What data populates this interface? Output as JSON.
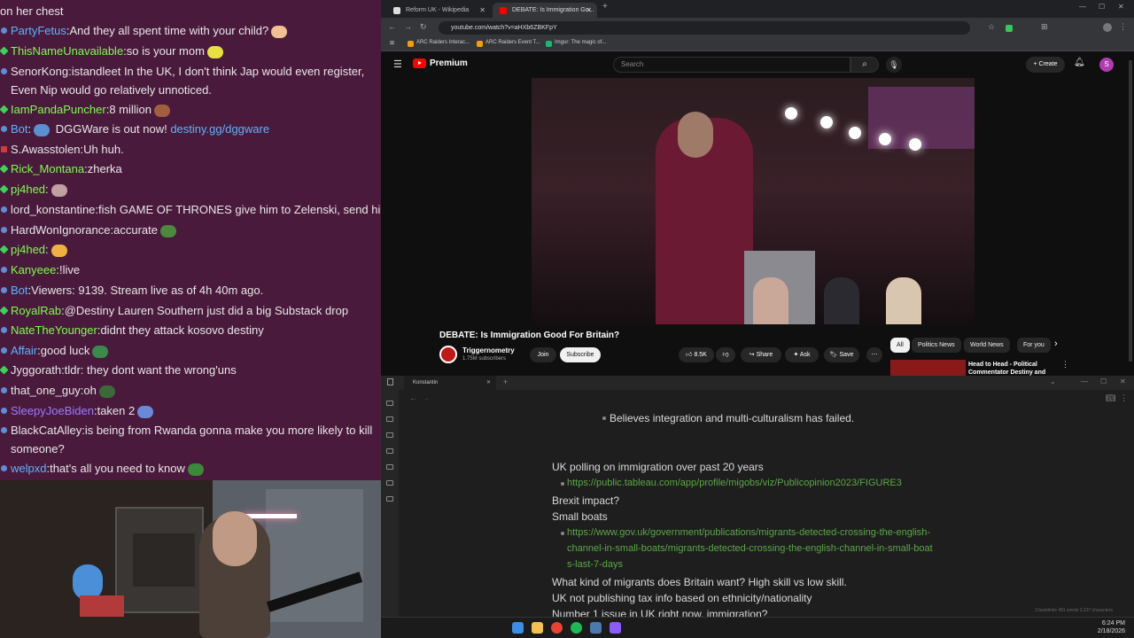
{
  "chat": {
    "messages": [
      {
        "user": "",
        "text": "on her chest",
        "user_color": "#ffffff"
      },
      {
        "user": "PartyFetus",
        "text": "And they all spent time with your child?",
        "user_color": "#5ab4ff"
      },
      {
        "user": "ThisNameUnavailable",
        "text": "so is your mom",
        "user_color": "#7cff4a"
      },
      {
        "user": "SenorKong",
        "text": "istandleet In the UK, I don't think Jap would even register, Even Nip would go relatively unnoticed.",
        "user_color": "#e8e8e8"
      },
      {
        "user": "IamPandaPuncher",
        "text": "8 million",
        "user_color": "#7cff4a"
      },
      {
        "user": "Bot",
        "text": "DGGWare is out now!",
        "link": "destiny.gg/dggware",
        "user_color": "#5ab4ff"
      },
      {
        "user": "S.Awasstolen",
        "text": "Uh huh.",
        "user_color": "#e8e8e8"
      },
      {
        "user": "Rick_Montana",
        "text": "zherka",
        "user_color": "#7cff4a"
      },
      {
        "user": "pj4hed",
        "text": "",
        "user_color": "#7cff4a"
      },
      {
        "user": "lord_konstantine",
        "text": "fish GAME OF THRONES give him to Zelenski, send him back",
        "user_color": "#e8e8e8"
      },
      {
        "user": "HardWonIgnorance",
        "text": "accurate",
        "user_color": "#e8e8e8"
      },
      {
        "user": "pj4hed",
        "text": "",
        "user_color": "#7cff4a"
      },
      {
        "user": "Kanyeee",
        "text": "!live",
        "user_color": "#7cff4a"
      },
      {
        "user": "Bot",
        "text": "Viewers: 9139. Stream live as of 4h 40m ago.",
        "user_color": "#5ab4ff"
      },
      {
        "user": "RoyalRab",
        "text": "@Destiny Lauren Southern just did a big Substack drop",
        "user_color": "#7cff4a"
      },
      {
        "user": "NateTheYounger",
        "text": "didnt they attack kosovo destiny",
        "user_color": "#7cff4a"
      },
      {
        "user": "Affair",
        "text": "good luck",
        "user_color": "#5ab4ff"
      },
      {
        "user": "Jyggorath",
        "text": "tldr: they dont want the wrong'uns",
        "user_color": "#e8e8e8"
      },
      {
        "user": "that_one_guy",
        "text": "oh",
        "user_color": "#e8e8e8"
      },
      {
        "user": "SleepyJoeBiden",
        "text": "taken 2",
        "user_color": "#9f7aff"
      },
      {
        "user": "BlackCatAlley",
        "text": "is being from Rwanda gonna make you more likely to kill someone?",
        "user_color": "#e8e8e8"
      },
      {
        "user": "welpxd",
        "text": "that's all you need to know",
        "user_color": "#5ab4ff"
      }
    ]
  },
  "browser": {
    "tabs": [
      {
        "label": "Reform UK - Wikipedia",
        "active": false
      },
      {
        "label": "DEBATE: Is Immigration Go...",
        "active": true
      }
    ],
    "new_tab": "+",
    "url": "youtube.com/watch?v=aHXb6ZBKFpY",
    "bookmarks": [
      "ARC Raiders Interac...",
      "ARC Raiders Event T...",
      "Imgur: The magic of..."
    ]
  },
  "youtube": {
    "brand": "Premium",
    "search_placeholder": "Search",
    "create_label": "Create",
    "avatar_letter": "S",
    "video_title": "DEBATE: Is Immigration Good For Britain?",
    "channel_name": "Triggernometry",
    "channel_subs": "1.75M subscribers",
    "join_label": "Join",
    "subscribe_label": "Subscribe",
    "likes": "8.5K",
    "share_label": "Share",
    "ask_label": "Ask",
    "save_label": "Save",
    "chips": [
      "All",
      "Politics News",
      "World News",
      "For you"
    ],
    "related_title": "Head to Head - Political Commentator Destiny and"
  },
  "notes": {
    "tab_title": "Konstantin",
    "lines": {
      "l1": "Believes integration and multi-culturalism has failed.",
      "l2": "UK polling on immigration over past 20 years",
      "l3": "https://public.tableau.com/app/profile/migobs/viz/Publicopinion2023/FIGURE3",
      "l4": "Brexit impact?",
      "l5": "Small boats",
      "l6a": "https://www.gov.uk/government/publications/migrants-detected-crossing-the-english-",
      "l6b": "channel-in-small-boats/migrants-detected-crossing-the-english-channel-in-small-boat",
      "l6c": "s-last-7-days",
      "l7": "What kind of migrants does Britain want? High skill vs low skill.",
      "l8": "UK not publishing tax info based on ethnicity/nationality",
      "l9": "Number 1 issue in UK right now, immigration?"
    },
    "status": "3 backlinks   481 words   3,237 characters"
  },
  "taskbar": {
    "time": "6:24 PM",
    "date": "2/18/2026"
  }
}
